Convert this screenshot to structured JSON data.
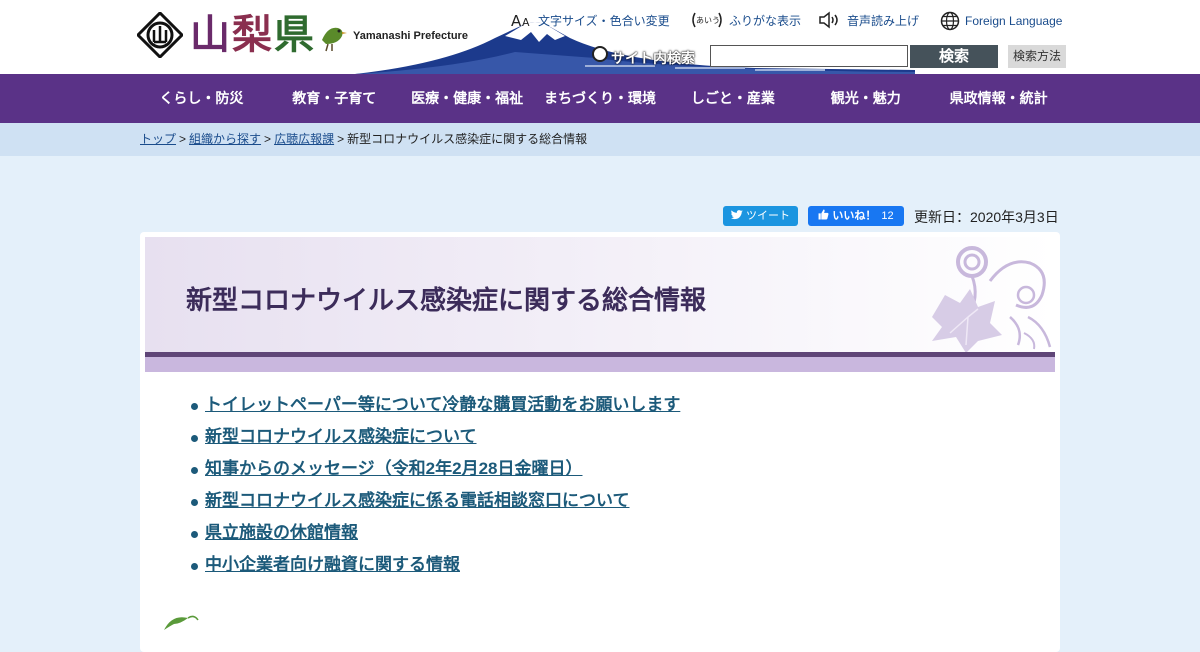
{
  "header": {
    "logo_text": [
      "山",
      "梨",
      "県"
    ],
    "logo_sub": "Yamanashi Prefecture",
    "utils": {
      "font_size": "文字サイズ・色合い変更",
      "furigana": "ふりがな表示",
      "voice": "音声読み上げ",
      "foreign": "Foreign Language"
    },
    "search": {
      "label": "サイト内検索",
      "value": "",
      "button": "検索",
      "help": "検索方法"
    }
  },
  "nav": {
    "items": [
      "くらし・防災",
      "教育・子育て",
      "医療・健康・福祉",
      "まちづくり・環境",
      "しごと・産業",
      "観光・魅力",
      "県政情報・統計"
    ]
  },
  "breadcrumb": {
    "items": [
      "トップ",
      "組織から探す",
      "広聴広報課"
    ],
    "current": "新型コロナウイルス感染症に関する総合情報",
    "sep": ">"
  },
  "share": {
    "tweet": "ツイート",
    "like": "いいね！",
    "like_count": "12"
  },
  "updated": "更新日：2020年3月3日",
  "page": {
    "title": "新型コロナウイルス感染症に関する総合情報",
    "links": [
      "トイレットペーパー等について冷静な購買活動をお願いします",
      "新型コロナウイルス感染症について",
      "知事からのメッセージ（令和2年2月28日金曜日）",
      "新型コロナウイルス感染症に係る電話相談窓口について",
      "県立施設の休館情報",
      "中小企業者向け融資に関する情報"
    ]
  },
  "colors": {
    "nav": "#5a3287",
    "breadcrumb_bg": "#cfe1f3",
    "page_bg": "#e4f0fa",
    "link": "#1c5a7a",
    "title_bar": "#5f4577",
    "title_band": "#c9b7de"
  },
  "icons": {
    "font_size": "aa-icon",
    "furigana": "furigana-icon",
    "voice": "speaker-icon",
    "foreign": "globe-icon",
    "tweet": "twitter-bird-icon",
    "like": "thumbs-up-icon"
  }
}
